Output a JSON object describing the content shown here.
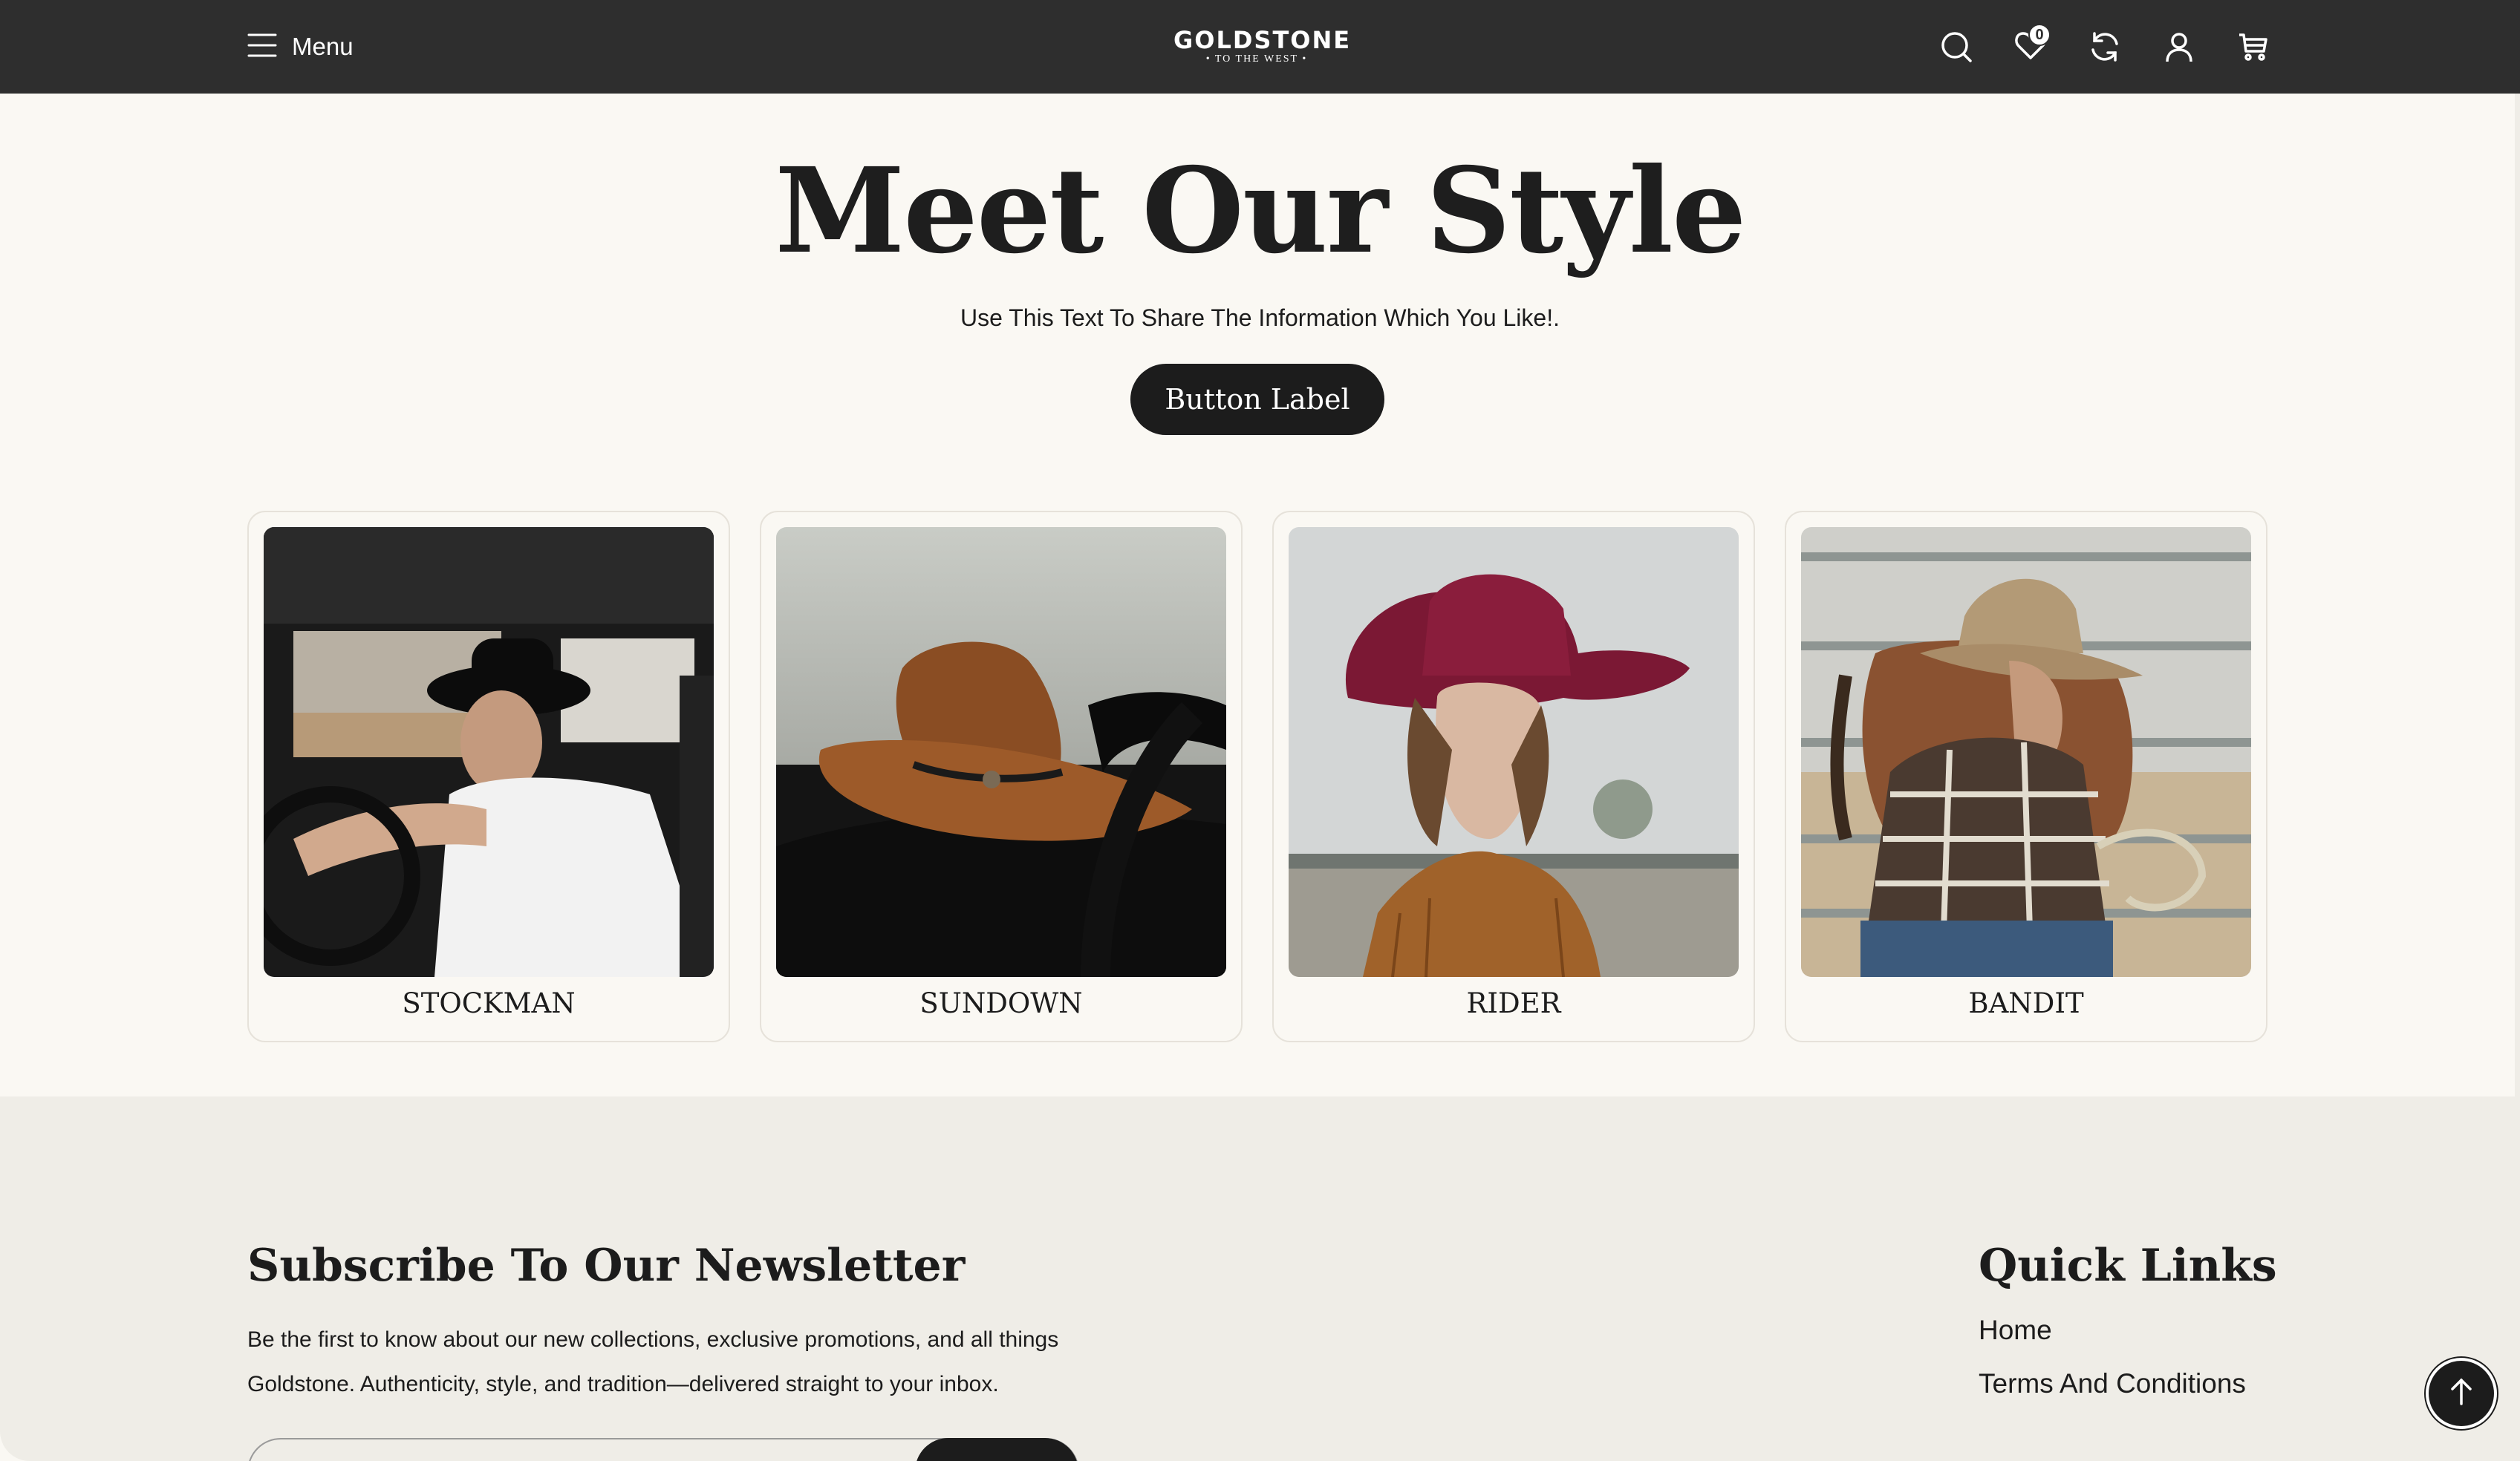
{
  "header": {
    "menu_label": "Menu",
    "logo_main": "GOLDSTONE",
    "logo_sub": "• TO THE WEST •",
    "wishlist_count": "0",
    "icons": [
      "search-icon",
      "heart-icon",
      "compare-icon",
      "account-icon",
      "cart-icon"
    ]
  },
  "hero": {
    "title": "Meet Our Style",
    "subtitle": "Use This Text To Share The Information Which You Like!.",
    "button_label": "Button Label"
  },
  "products": [
    {
      "name": "STOCKMAN"
    },
    {
      "name": "SUNDOWN"
    },
    {
      "name": "RIDER"
    },
    {
      "name": "BANDIT"
    }
  ],
  "newsletter": {
    "title": "Subscribe To Our Newsletter",
    "text": "Be the first to know about our new collections, exclusive promotions, and all things Goldstone. Authenticity, style, and tradition—delivered straight to your inbox."
  },
  "quick_links": {
    "title": "Quick Links",
    "links": [
      "Home",
      "Terms And Conditions"
    ]
  },
  "colors": {
    "header_bg": "#2e2e2e",
    "page_bg": "#faf8f3",
    "footer_bg": "#efede7",
    "accent": "#1c1c1c"
  }
}
